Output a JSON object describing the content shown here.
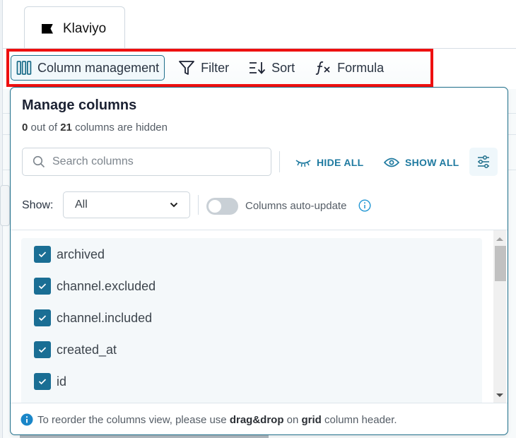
{
  "tab": {
    "label": "Klaviyo",
    "icon": "flag-icon"
  },
  "toolbar": {
    "column_management": "Column management",
    "filter": "Filter",
    "sort": "Sort",
    "formula": "Formula"
  },
  "panel": {
    "title": "Manage columns",
    "hidden_count": "0",
    "total_count": "21",
    "sub_middle": " out of ",
    "sub_end": " columns are hidden",
    "search_placeholder": "Search columns",
    "hide_all": "HIDE ALL",
    "show_all": "SHOW ALL",
    "show_label": "Show:",
    "show_value": "All",
    "auto_update_label": "Columns auto-update",
    "auto_update_on": false,
    "columns": [
      {
        "name": "archived",
        "checked": true
      },
      {
        "name": "channel.excluded",
        "checked": true
      },
      {
        "name": "channel.included",
        "checked": true
      },
      {
        "name": "created_at",
        "checked": true
      },
      {
        "name": "id",
        "checked": true
      }
    ],
    "footer": {
      "pre": "To reorder the columns view, please use ",
      "bold1": "drag&drop",
      "mid": " on ",
      "bold2": "grid",
      "post": " column header."
    }
  },
  "colors": {
    "accent": "#1f7aa0",
    "checkbox": "#1a6e94",
    "highlight_border": "#ee1010"
  }
}
